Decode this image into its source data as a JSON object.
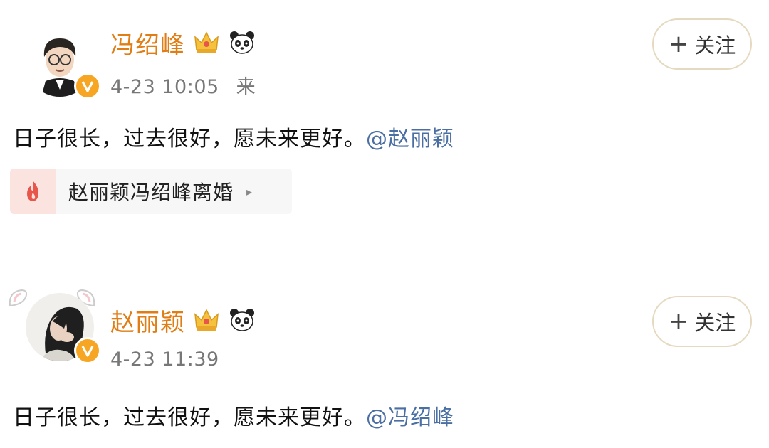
{
  "posts": [
    {
      "author": "冯绍峰",
      "time": "4-23 10:05",
      "source": "来",
      "follow_label": "关注",
      "follow_plus": "+",
      "text": "日子很长，过去很好，愿未来更好。",
      "mention": "@赵丽颖",
      "topic": {
        "label": "赵丽颖冯绍峰离婚",
        "arrow": "▸",
        "icon": "fire-icon"
      },
      "icons": [
        "verified-badge-icon",
        "crown-icon",
        "panda-icon"
      ]
    },
    {
      "author": "赵丽颖",
      "time": "4-23 11:39",
      "follow_label": "关注",
      "follow_plus": "+",
      "text": "日子很长，过去很好，愿未来更好。",
      "mention": "@冯绍峰",
      "icons": [
        "verified-badge-icon",
        "crown-icon",
        "panda-icon"
      ]
    }
  ],
  "colors": {
    "name": "#e07d15",
    "mention": "#4b6fa3",
    "meta": "#777777",
    "badge": "#f6a623",
    "topic_bg": "#f7f7f7",
    "topic_icon_bg": "#fbe3e0",
    "fire": "#e8554b"
  }
}
